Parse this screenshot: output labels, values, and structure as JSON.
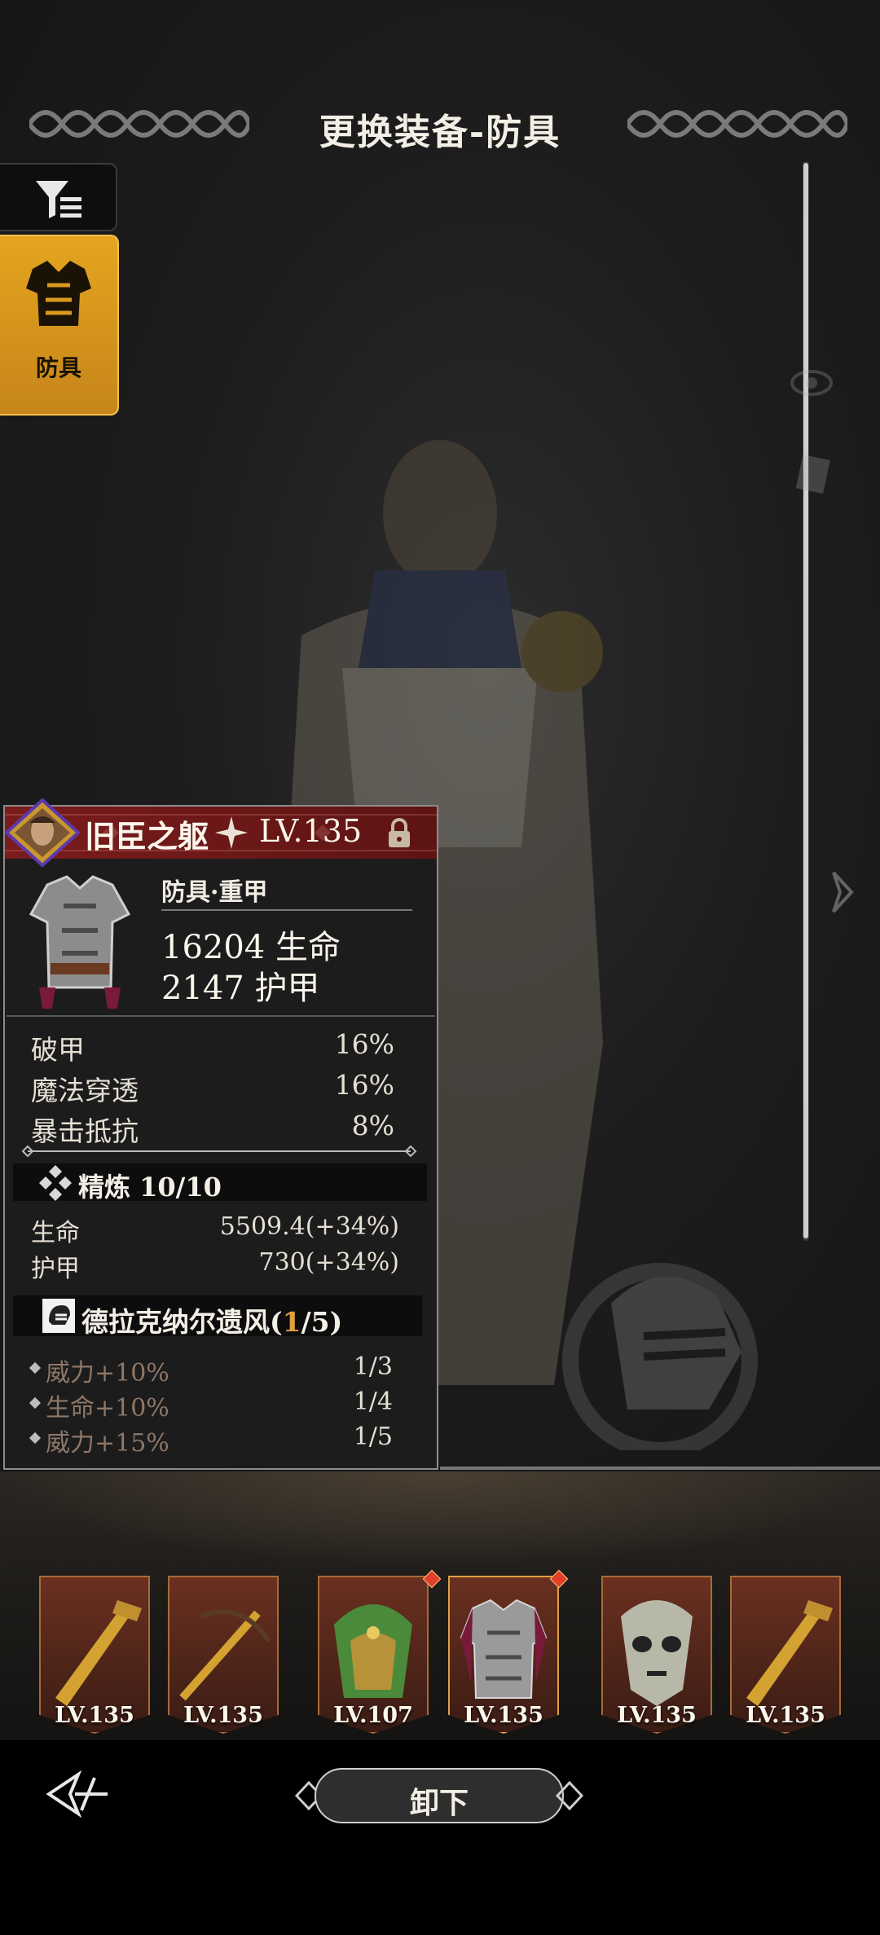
{
  "screen": {
    "title": "更换装备-防具"
  },
  "sidebar": {
    "filter_icon": "filter-icon",
    "category_tab": {
      "label": "防具",
      "icon": "armor-icon",
      "selected": true
    }
  },
  "equipment": {
    "name": "旧臣之躯",
    "level": "LV.135",
    "type": "防具·重甲",
    "main_stats": [
      {
        "value": "16204",
        "name": "生命"
      },
      {
        "value": "2147",
        "name": "护甲"
      }
    ],
    "sub_stats": [
      {
        "label": "破甲",
        "value": "16%"
      },
      {
        "label": "魔法穿透",
        "value": "16%"
      },
      {
        "label": "暴击抵抗",
        "value": "8%"
      }
    ],
    "refine": {
      "label": "精炼 10/10",
      "stats": [
        {
          "label": "生命",
          "value": "5509.4(+34%)"
        },
        {
          "label": "护甲",
          "value": "730(+34%)"
        }
      ]
    },
    "set": {
      "name": "德拉克纳尔遗风(",
      "progress_current": "1",
      "progress_total": "/5)",
      "bonuses": [
        {
          "label": "威力+10%",
          "count": "1/3"
        },
        {
          "label": "生命+10%",
          "count": "1/4"
        },
        {
          "label": "威力+15%",
          "count": "1/5"
        }
      ]
    }
  },
  "slots": [
    {
      "level": "LV.135",
      "item": "golden-gun",
      "new": false
    },
    {
      "level": "LV.135",
      "item": "crossbow",
      "new": false
    },
    {
      "level": "LV.107",
      "item": "leaf-helmet",
      "new": true
    },
    {
      "level": "LV.135",
      "item": "plate-armor",
      "new": true,
      "selected": true
    },
    {
      "level": "LV.135",
      "item": "skull-mask",
      "new": false
    },
    {
      "level": "LV.135",
      "item": "golden-gun",
      "new": false
    }
  ],
  "footer": {
    "unequip_label": "卸下",
    "back_icon": "back-icon"
  },
  "colors": {
    "accent_gold": "#e4a51e",
    "header_red": "#7a1c1c",
    "set_progress": "#e0a040",
    "new_badge": "#e0402a"
  }
}
